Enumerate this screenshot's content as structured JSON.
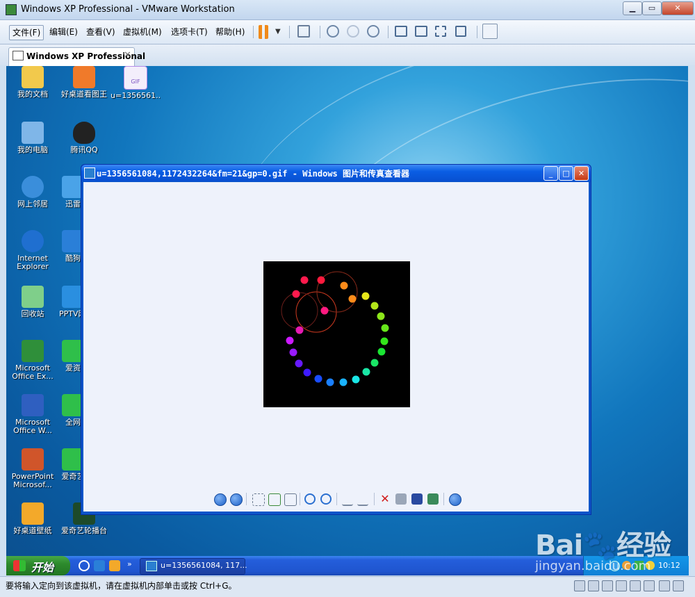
{
  "host": {
    "title": "Windows XP Professional - VMware Workstation",
    "menu": [
      "文件(F)",
      "编辑(E)",
      "查看(V)",
      "虚拟机(M)",
      "选项卡(T)",
      "帮助(H)"
    ],
    "tab_label": "Windows XP Professional",
    "status_text": "要将输入定向到该虚拟机，请在虚拟机内部单击或按 Ctrl+G。"
  },
  "desktop": {
    "icons": [
      {
        "label": "我的文档",
        "icon": "my-documents-icon",
        "color": "#f2c94c"
      },
      {
        "label": "好桌道看图王",
        "icon": "image-viewer-icon",
        "color": "#f07a2a"
      },
      {
        "label": "u=1356561...",
        "icon": "gif-file-icon",
        "color": "#b48be8"
      },
      {
        "label": "我的电脑",
        "icon": "my-computer-icon",
        "color": "#7fb6e8"
      },
      {
        "label": "腾讯QQ",
        "icon": "qq-icon",
        "color": "#222222"
      },
      {
        "label": "网上邻居",
        "icon": "network-icon",
        "color": "#3a8edb"
      },
      {
        "label": "迅雷",
        "icon": "thunder-icon",
        "color": "#4aa3e8"
      },
      {
        "label": "Internet Explorer",
        "icon": "ie-icon",
        "color": "#1f6fd0"
      },
      {
        "label": "酷狗",
        "icon": "kugou-icon",
        "color": "#2a7fd8"
      },
      {
        "label": "回收站",
        "icon": "recycle-bin-icon",
        "color": "#7fcf8a"
      },
      {
        "label": "PPTV网络",
        "icon": "pptv-icon",
        "color": "#2a8fe0"
      },
      {
        "label": "Microsoft Office Ex...",
        "icon": "excel-icon",
        "color": "#2f8f3a"
      },
      {
        "label": "爱资",
        "icon": "app-icon",
        "color": "#2fbf4a"
      },
      {
        "label": "Microsoft Office W...",
        "icon": "word-icon",
        "color": "#2f5fc0"
      },
      {
        "label": "全网",
        "icon": "app-icon",
        "color": "#2fbf4a"
      },
      {
        "label": "PowerPoint Microsof...",
        "icon": "powerpoint-icon",
        "color": "#d0552a"
      },
      {
        "label": "爱奇艺",
        "icon": "iqiyi-icon",
        "color": "#2fbf4a"
      },
      {
        "label": "好桌道壁纸",
        "icon": "wallpaper-icon",
        "color": "#f3a92a"
      },
      {
        "label": "爱奇艺轮播台",
        "icon": "iqiyi-carousel-icon",
        "color": "#1d4a2a"
      }
    ]
  },
  "viewer": {
    "title": "u=1356561084,1172432264&fm=21&gp=0.gif - Windows 图片和传真查看器",
    "loading_dot_colors": [
      "#ff1a4d",
      "#ff1a3d",
      "#ff8c1a",
      "#ff8c1a",
      "#e6e61a",
      "#b3e61a",
      "#8ce61a",
      "#66e61a",
      "#33e61a",
      "#1ae633",
      "#1ae666",
      "#1ae6a6",
      "#1ae6e6",
      "#1ab3ff",
      "#1a80ff",
      "#1a4dff",
      "#3d1aff",
      "#661aff",
      "#991aff",
      "#cc1aff",
      "#e61ab3",
      "#ff1a80",
      "#ff1a4d"
    ]
  },
  "taskbar": {
    "start_label": "开始",
    "task_label": "u=1356561084, 117...",
    "clock": "10:12"
  },
  "watermark": {
    "logo": "Bai🐾经验",
    "url": "jingyan.baidu.com"
  }
}
